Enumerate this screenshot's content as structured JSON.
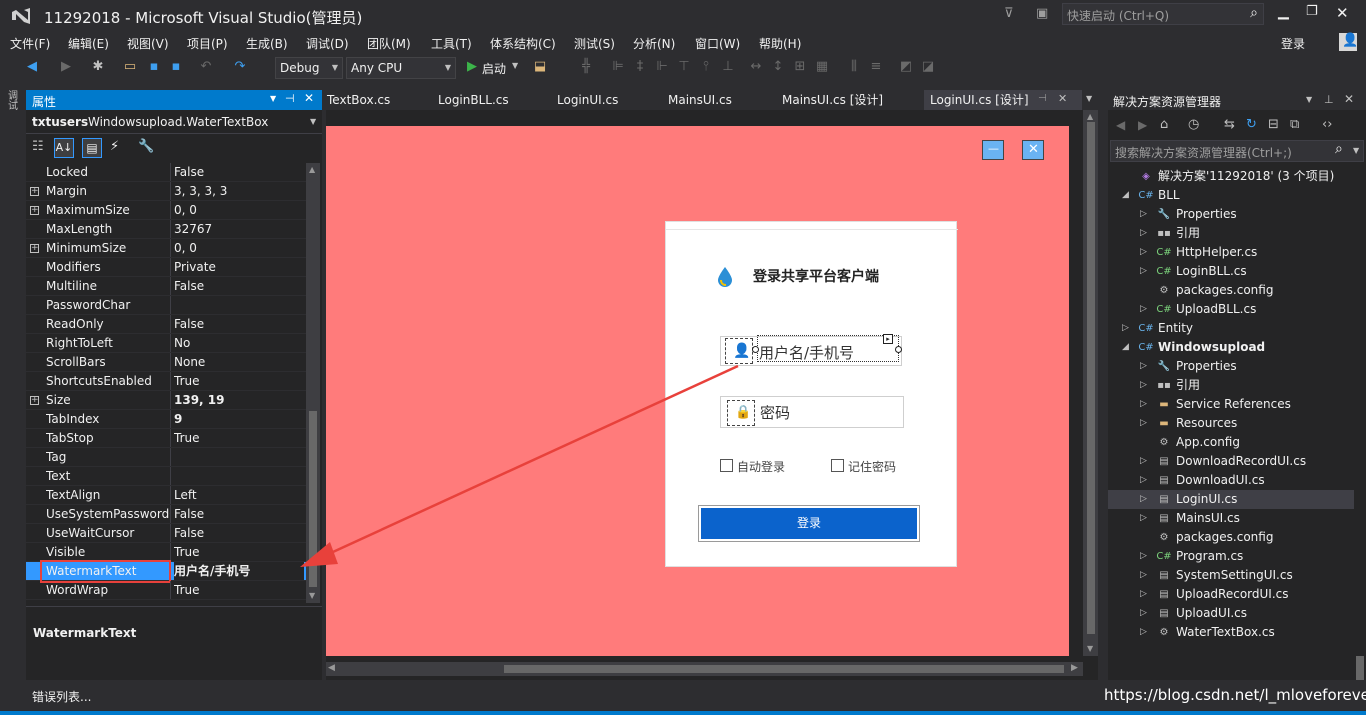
{
  "titlebar": {
    "title": "11292018 - Microsoft Visual Studio(管理员)",
    "quick_launch_placeholder": "快速启动 (Ctrl+Q)",
    "signin": "登录"
  },
  "menu": [
    "文件(F)",
    "编辑(E)",
    "视图(V)",
    "项目(P)",
    "生成(B)",
    "调试(D)",
    "团队(M)",
    "工具(T)",
    "体系结构(C)",
    "测试(S)",
    "分析(N)",
    "窗口(W)",
    "帮助(H)"
  ],
  "toolbar": {
    "config": "Debug",
    "platform": "Any CPU",
    "start": "启动"
  },
  "properties": {
    "title": "属性",
    "object_name": "txtusers",
    "object_type": "Windowsupload.WaterTextBox",
    "rows": [
      {
        "name": "Locked",
        "value": "False"
      },
      {
        "name": "Margin",
        "value": "3, 3, 3, 3",
        "exp": "⊞"
      },
      {
        "name": "MaximumSize",
        "value": "0, 0",
        "exp": "⊞"
      },
      {
        "name": "MaxLength",
        "value": "32767"
      },
      {
        "name": "MinimumSize",
        "value": "0, 0",
        "exp": "⊞"
      },
      {
        "name": "Modifiers",
        "value": "Private"
      },
      {
        "name": "Multiline",
        "value": "False"
      },
      {
        "name": "PasswordChar",
        "value": ""
      },
      {
        "name": "ReadOnly",
        "value": "False"
      },
      {
        "name": "RightToLeft",
        "value": "No"
      },
      {
        "name": "ScrollBars",
        "value": "None"
      },
      {
        "name": "ShortcutsEnabled",
        "value": "True"
      },
      {
        "name": "Size",
        "value": "139, 19",
        "exp": "⊞"
      },
      {
        "name": "TabIndex",
        "value": "9"
      },
      {
        "name": "TabStop",
        "value": "True"
      },
      {
        "name": "Tag",
        "value": ""
      },
      {
        "name": "Text",
        "value": ""
      },
      {
        "name": "TextAlign",
        "value": "Left"
      },
      {
        "name": "UseSystemPasswordChar",
        "value": "False"
      },
      {
        "name": "UseWaitCursor",
        "value": "False"
      },
      {
        "name": "Visible",
        "value": "True"
      },
      {
        "name": "WatermarkText",
        "value": "用户名/手机号"
      },
      {
        "name": "WordWrap",
        "value": "True"
      }
    ],
    "description_title": "WatermarkText"
  },
  "tabs": [
    "TextBox.cs",
    "LoginBLL.cs",
    "LoginUI.cs",
    "MainsUI.cs",
    "MainsUI.cs [设计]",
    "LoginUI.cs [设计]"
  ],
  "form": {
    "title": "登录共享平台客户端",
    "username_watermark": "用户名/手机号",
    "password_watermark": "密码",
    "auto_login": "自动登录",
    "remember_password": "记住密码",
    "login_button": "登录",
    "min_glyph": "—",
    "close_glyph": "✕"
  },
  "solution_explorer": {
    "title": "解决方案资源管理器",
    "search_placeholder": "搜索解决方案资源管理器(Ctrl+;)",
    "nodes": [
      {
        "label": "解决方案'11292018' (3 个项目)",
        "icon": "solution-icon",
        "arrow": ""
      },
      {
        "label": "BLL",
        "icon": "csproj-icon",
        "arrow": "◢"
      },
      {
        "label": "Properties",
        "icon": "wrench-icon",
        "arrow": "▷"
      },
      {
        "label": "引用",
        "icon": "references-icon",
        "arrow": "▷"
      },
      {
        "label": "HttpHelper.cs",
        "icon": "csharp-file-icon",
        "arrow": "▷"
      },
      {
        "label": "LoginBLL.cs",
        "icon": "csharp-file-icon",
        "arrow": "▷"
      },
      {
        "label": "packages.config",
        "icon": "config-icon",
        "arrow": ""
      },
      {
        "label": "UploadBLL.cs",
        "icon": "csharp-file-icon",
        "arrow": "▷"
      },
      {
        "label": "Entity",
        "icon": "csproj-icon",
        "arrow": "▷"
      },
      {
        "label": "Windowsupload",
        "icon": "csproj-icon",
        "arrow": "◢"
      },
      {
        "label": "Properties",
        "icon": "wrench-icon",
        "arrow": "▷"
      },
      {
        "label": "引用",
        "icon": "references-icon",
        "arrow": "▷"
      },
      {
        "label": "Service References",
        "icon": "folder-icon",
        "arrow": "▷"
      },
      {
        "label": "Resources",
        "icon": "folder-icon",
        "arrow": "▷"
      },
      {
        "label": "App.config",
        "icon": "config-icon",
        "arrow": ""
      },
      {
        "label": "DownloadRecordUI.cs",
        "icon": "form-icon",
        "arrow": "▷"
      },
      {
        "label": "DownloadUI.cs",
        "icon": "form-icon",
        "arrow": "▷"
      },
      {
        "label": "LoginUI.cs",
        "icon": "form-icon",
        "arrow": "▷"
      },
      {
        "label": "MainsUI.cs",
        "icon": "form-icon",
        "arrow": "▷"
      },
      {
        "label": "packages.config",
        "icon": "config-icon",
        "arrow": ""
      },
      {
        "label": "Program.cs",
        "icon": "csharp-file-icon",
        "arrow": "▷"
      },
      {
        "label": "SystemSettingUI.cs",
        "icon": "form-icon",
        "arrow": "▷"
      },
      {
        "label": "UploadRecordUI.cs",
        "icon": "form-icon",
        "arrow": "▷"
      },
      {
        "label": "UploadUI.cs",
        "icon": "form-icon",
        "arrow": "▷"
      },
      {
        "label": "WaterTextBox.cs",
        "icon": "component-icon",
        "arrow": "▷"
      }
    ]
  },
  "statusbar": {
    "error_list": "错误列表...",
    "watermark": "https://blog.csdn.net/l_mloveforever"
  },
  "left_strip": "调\n试",
  "colors": {
    "accent": "#007acc",
    "surface": "#ff7b7b",
    "login_button": "#0b63cc",
    "arrow": "#e8413b"
  }
}
